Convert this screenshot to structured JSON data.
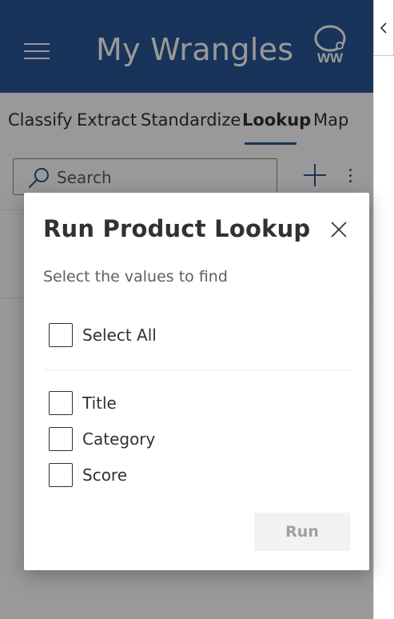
{
  "header": {
    "title": "My Wrangles",
    "logo_text": "WW",
    "brand_color": "#2b5797"
  },
  "tabs": [
    {
      "label": "Classify",
      "active": false
    },
    {
      "label": "Extract",
      "active": false
    },
    {
      "label": "Standardize",
      "active": false
    },
    {
      "label": "Lookup",
      "active": true
    },
    {
      "label": "Map",
      "active": false
    }
  ],
  "search": {
    "placeholder": "Search",
    "value": ""
  },
  "icons": {
    "menu": "hamburger-icon",
    "search": "search-icon",
    "add": "plus-icon",
    "more": "more-vertical-icon",
    "collapse": "chevron-left-icon",
    "close": "close-icon"
  },
  "dialog": {
    "title": "Run Product Lookup",
    "subtitle": "Select the values to find",
    "select_all_label": "Select All",
    "select_all_checked": false,
    "options": [
      {
        "label": "Title",
        "checked": false
      },
      {
        "label": "Category",
        "checked": false
      },
      {
        "label": "Score",
        "checked": false
      }
    ],
    "run_label": "Run",
    "run_enabled": false
  }
}
